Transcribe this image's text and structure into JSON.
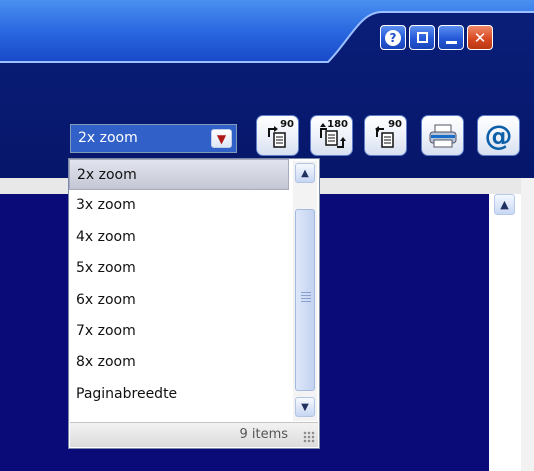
{
  "window_controls": {
    "help_icon": "help-icon",
    "restore_icon": "restore-icon",
    "minimize_icon": "minimize-icon",
    "close_icon": "close-icon",
    "help_glyph": "?",
    "close_glyph": "✕"
  },
  "zoom_select": {
    "value": "2x zoom",
    "arrow_icon": "chevron-down-icon",
    "arrow_glyph": "▼"
  },
  "toolbar": {
    "rotate_right_90_label": "90",
    "rotate_180_label": "180",
    "rotate_left_90_label": "90",
    "print_icon": "printer-icon",
    "email_glyph": "@"
  },
  "zoom_list": {
    "items": [
      "2x zoom",
      "3x zoom",
      "4x zoom",
      "5x zoom",
      "6x zoom",
      "7x zoom",
      "8x zoom",
      "Paginabreedte"
    ],
    "selected_index": 0,
    "count_text": "9 items"
  },
  "colors": {
    "header_navy": "#06166a",
    "content_navy": "#0a0a78",
    "combo_blue": "#3060c8",
    "close_red": "#d84a22"
  }
}
